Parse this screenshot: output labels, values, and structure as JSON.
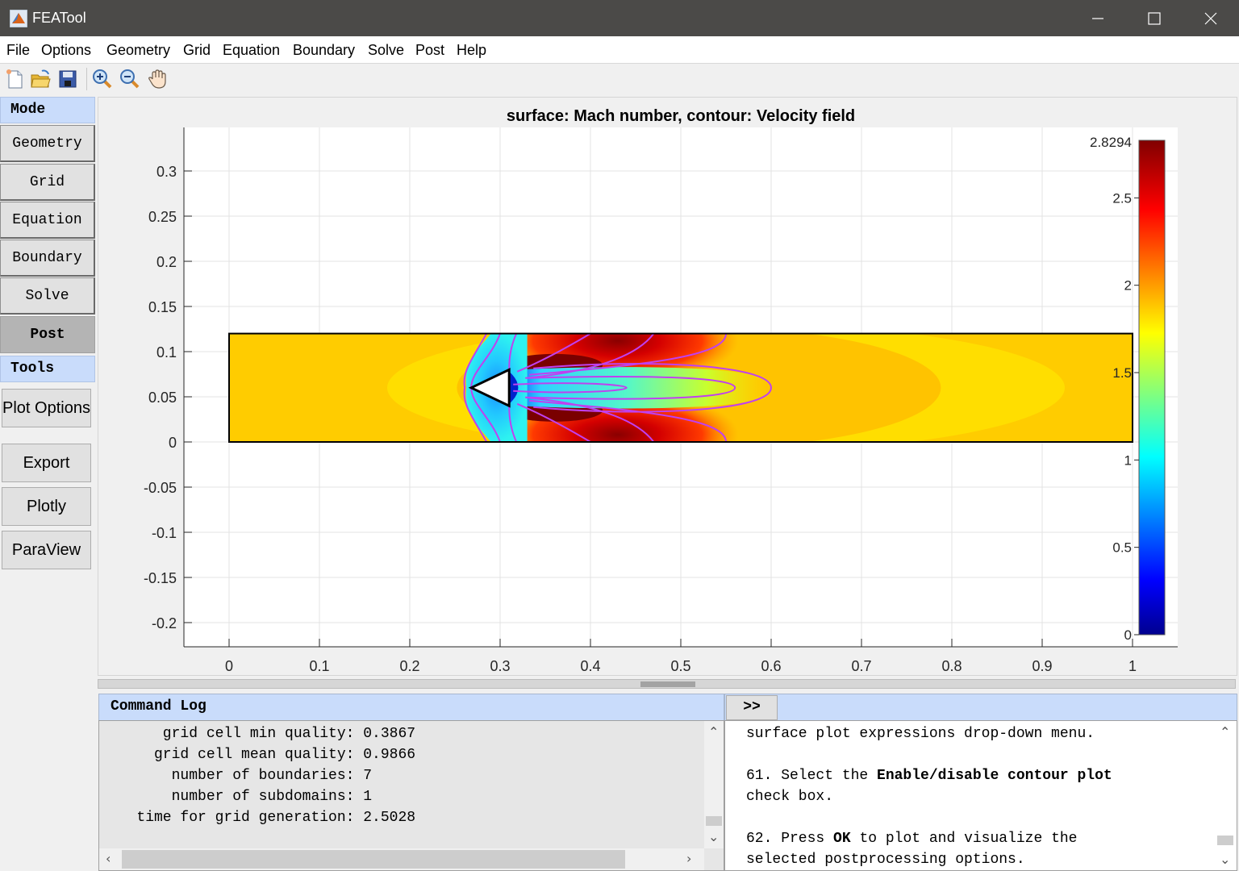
{
  "window": {
    "title": "FEATool",
    "controls": [
      "minimize",
      "maximize",
      "close"
    ]
  },
  "menu": [
    "File",
    "Options",
    "Geometry",
    "Grid",
    "Equation",
    "Boundary",
    "Solve",
    "Post",
    "Help"
  ],
  "toolbar": {
    "buttons": [
      {
        "name": "new-file",
        "icon": "new-document-icon"
      },
      {
        "name": "open-file",
        "icon": "open-folder-icon"
      },
      {
        "name": "save-file",
        "icon": "floppy-disk-icon"
      },
      {
        "name": "zoom-in",
        "icon": "zoom-in-icon"
      },
      {
        "name": "zoom-out",
        "icon": "zoom-out-icon"
      },
      {
        "name": "pan",
        "icon": "hand-pan-icon"
      }
    ]
  },
  "sidebar": {
    "mode_header": "Mode",
    "mode_buttons": [
      "Geometry",
      "Grid",
      "Equation",
      "Boundary",
      "Solve",
      "Post"
    ],
    "active_mode": "Post",
    "tools_header": "Tools",
    "tool_buttons": [
      "Plot Options",
      "Export",
      "Plotly",
      "ParaView"
    ]
  },
  "chart_data": {
    "type": "heatmap",
    "title": "surface: Mach number, contour: Velocity field",
    "surface_variable": "Mach number",
    "contour_variable": "Velocity field",
    "xlabel": "",
    "ylabel": "",
    "xlim": [
      -0.05,
      1.05
    ],
    "ylim": [
      -0.227,
      0.34
    ],
    "xticks": [
      0,
      0.1,
      0.2,
      0.3,
      0.4,
      0.5,
      0.6,
      0.7,
      0.8,
      0.9,
      1
    ],
    "xtick_labels": [
      "0",
      "0.1",
      "0.2",
      "0.3",
      "0.4",
      "0.5",
      "0.6",
      "0.7",
      "0.8",
      "0.9",
      "1"
    ],
    "yticks": [
      -0.2,
      -0.15,
      -0.1,
      -0.05,
      0,
      0.05,
      0.1,
      0.15,
      0.2,
      0.25,
      0.3
    ],
    "ytick_labels": [
      "-0.2",
      "-0.15",
      "-0.1",
      "-0.05",
      "0",
      "0.05",
      "0.1",
      "0.15",
      "0.2",
      "0.25",
      "0.3"
    ],
    "grid": true,
    "domain": {
      "xmin": 0,
      "xmax": 1,
      "ymin": 0,
      "ymax": 0.12
    },
    "obstacle": {
      "shape": "triangle",
      "vertices": [
        [
          0.268,
          0.06
        ],
        [
          0.31,
          0.08
        ],
        [
          0.31,
          0.04
        ]
      ]
    },
    "freestream_mach": 1.8,
    "colorbar": {
      "colormap": "jet",
      "min": 0,
      "max": 2.8294,
      "max_label": "2.8294",
      "ticks": [
        0,
        0.5,
        1,
        1.5,
        2,
        2.5
      ],
      "tick_labels": [
        "0",
        "0.5",
        "1",
        "1.5",
        "2",
        "2.5"
      ],
      "placement": "right"
    }
  },
  "command_log": {
    "header": "Command Log",
    "lines": [
      "      grid cell min quality: 0.3867",
      "     grid cell mean quality: 0.9866",
      "       number of boundaries: 7",
      "       number of subdomains: 1",
      "   time for grid generation: 2.5028"
    ]
  },
  "help_panel": {
    "toggle_label": ">>",
    "lines": [
      [
        {
          "t": "surface plot expressions drop-down menu.",
          "b": false
        }
      ],
      [],
      [
        {
          "t": "61. Select the ",
          "b": false
        },
        {
          "t": "Enable/disable contour plot",
          "b": true
        }
      ],
      [
        {
          "t": "check box.",
          "b": false
        }
      ],
      [],
      [
        {
          "t": "62. Press ",
          "b": false
        },
        {
          "t": "OK",
          "b": true
        },
        {
          "t": " to plot and visualize the",
          "b": false
        }
      ],
      [
        {
          "t": "selected postprocessing options.",
          "b": false
        }
      ]
    ]
  }
}
